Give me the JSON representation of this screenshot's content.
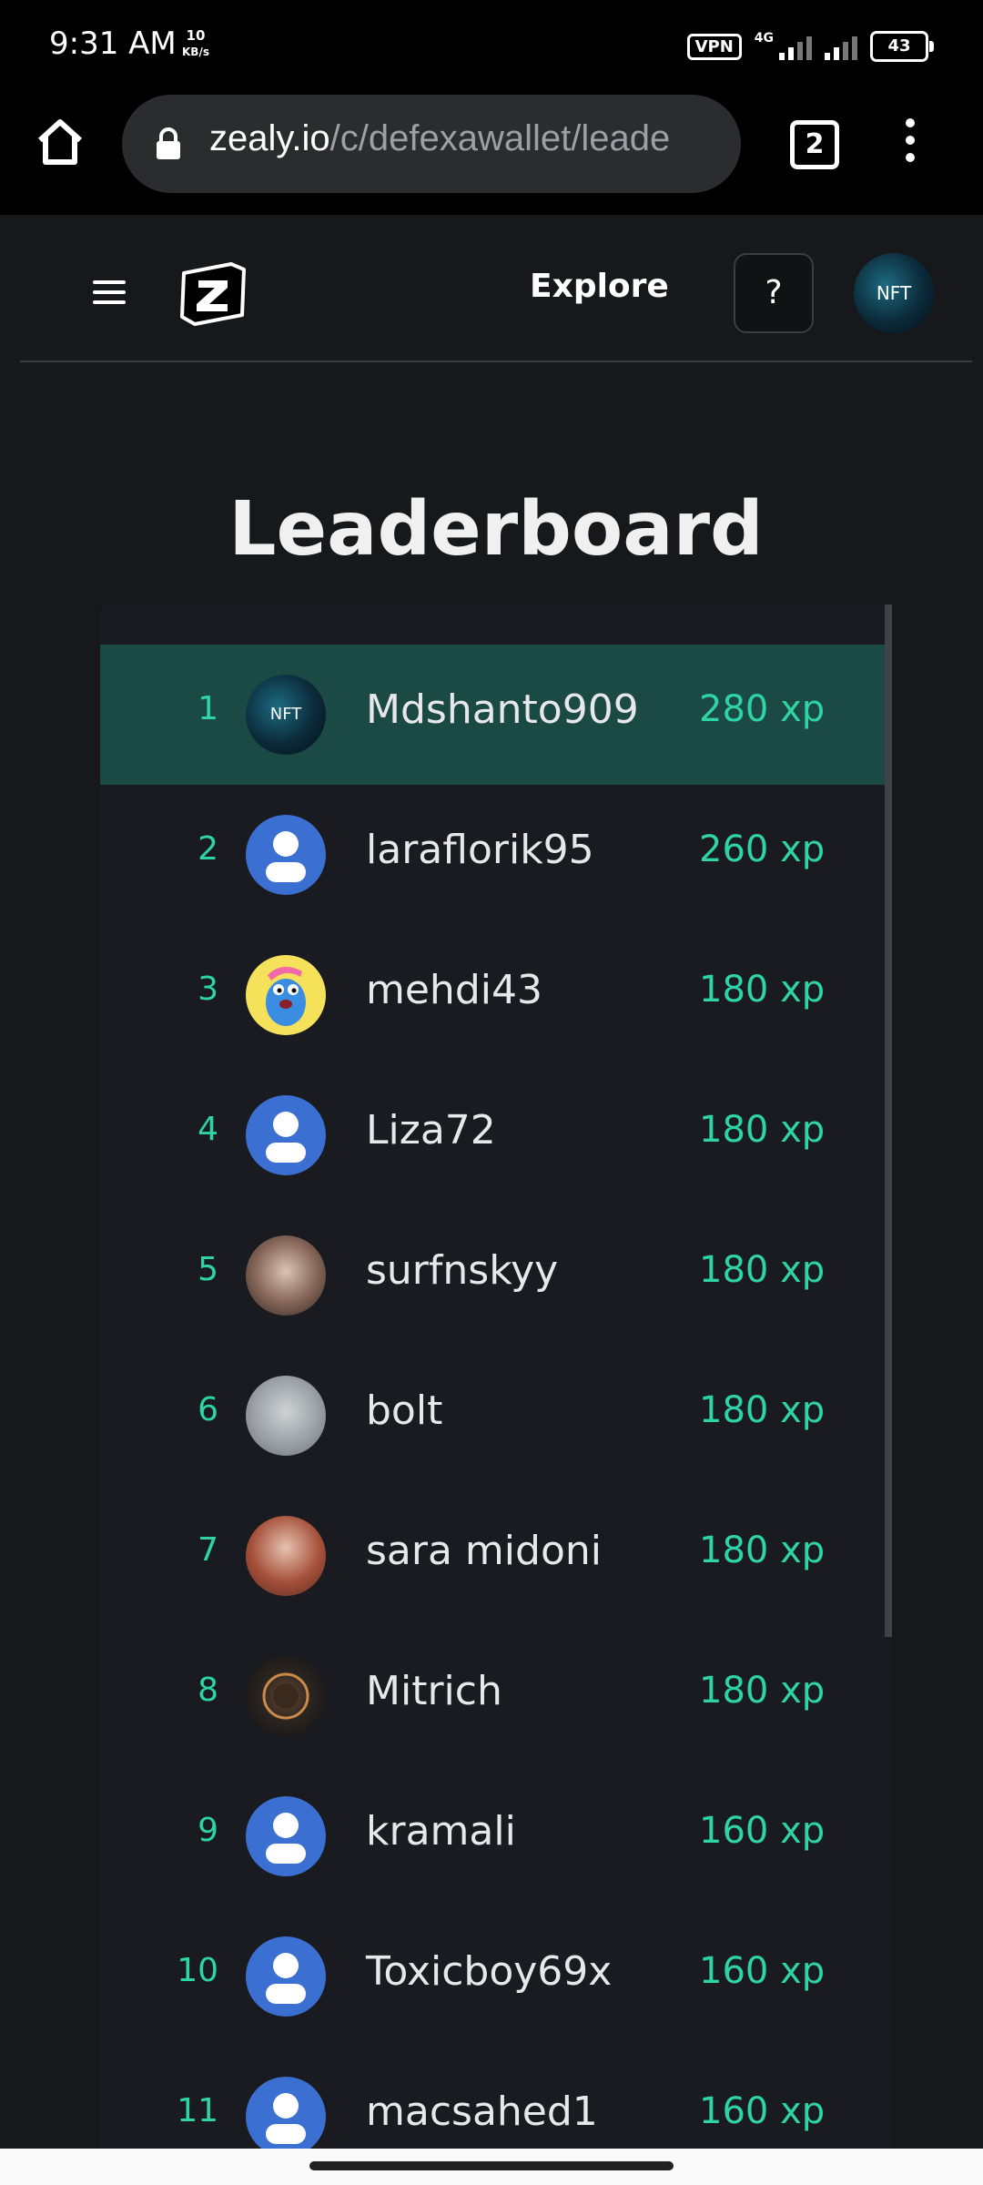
{
  "status_bar": {
    "time": "9:31 AM",
    "speed_value": "10",
    "speed_unit": "KB/s",
    "vpn": "VPN",
    "network": "4G",
    "battery": "43"
  },
  "browser": {
    "url_host": "zealy.io",
    "url_path": "/c/defexawallet/leade",
    "tab_count": "2"
  },
  "header": {
    "explore_label": "Explore",
    "help_label": "?",
    "avatar_text": "NFT"
  },
  "leaderboard": {
    "title": "Leaderboard",
    "rows": [
      {
        "rank": "1",
        "name": "Mdshanto909",
        "xp": "280 xp",
        "avatar": "nft",
        "avatar_text": "NFT"
      },
      {
        "rank": "2",
        "name": "laraflorik95",
        "xp": "260 xp",
        "avatar": "default"
      },
      {
        "rank": "3",
        "name": "mehdi43",
        "xp": "180 xp",
        "avatar": "cartoon"
      },
      {
        "rank": "4",
        "name": "Liza72",
        "xp": "180 xp",
        "avatar": "default"
      },
      {
        "rank": "5",
        "name": "surfnskyy",
        "xp": "180 xp",
        "avatar": "photo"
      },
      {
        "rank": "6",
        "name": "bolt",
        "xp": "180 xp",
        "avatar": "photo"
      },
      {
        "rank": "7",
        "name": "sara midoni",
        "xp": "180 xp",
        "avatar": "photo"
      },
      {
        "rank": "8",
        "name": "Mitrich",
        "xp": "180 xp",
        "avatar": "logo"
      },
      {
        "rank": "9",
        "name": "kramali",
        "xp": "160 xp",
        "avatar": "default"
      },
      {
        "rank": "10",
        "name": "Toxicboy69x",
        "xp": "160 xp",
        "avatar": "default"
      },
      {
        "rank": "11",
        "name": "macsahed1",
        "xp": "160 xp",
        "avatar": "default"
      }
    ]
  },
  "colors": {
    "accent": "#2ed3a6",
    "highlight_row": "#1b4a44",
    "background": "#16181b"
  }
}
